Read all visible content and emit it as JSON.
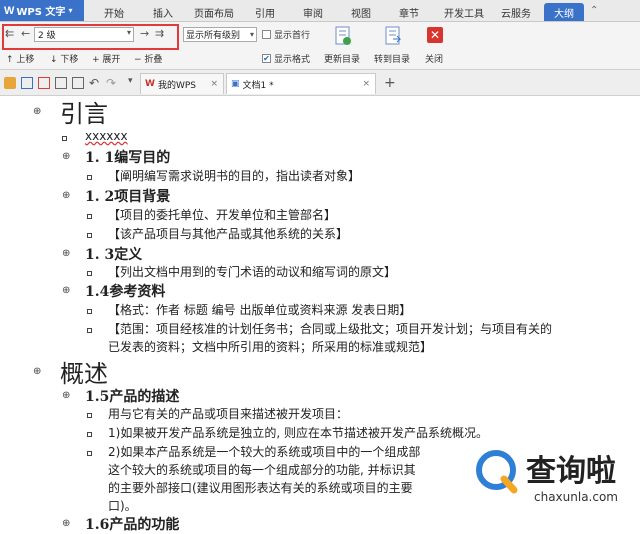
{
  "app": {
    "name": "WPS 文字"
  },
  "menu_tabs": [
    "开始",
    "插入",
    "页面布局",
    "引用",
    "审阅",
    "视图",
    "章节",
    "开发工具",
    "云服务",
    "大纲"
  ],
  "ribbon": {
    "level_value": "2 级",
    "show_levels_value": "显示所有级别",
    "show_first_line": "显示首行",
    "show_format": "显示格式",
    "move_up": "上移",
    "move_down": "下移",
    "expand": "展开",
    "collapse": "折叠",
    "update_toc": "更新目录",
    "goto_toc": "转到目录",
    "close": "关闭"
  },
  "doc_tabs": [
    {
      "label": "我的WPS"
    },
    {
      "label": "文档1 *"
    }
  ],
  "outline": {
    "h1_intro": "引言",
    "placeholder": "xxxxxx",
    "h2_1": "1. 1编写目的",
    "b_1_1": "【阐明编写需求说明书的目的，指出读者对象】",
    "h2_2": "1. 2项目背景",
    "b_2_1": "【项目的委托单位、开发单位和主管部名】",
    "b_2_2": "【该产品项目与其他产品或其他系统的关系】",
    "h2_3": "1. 3定义",
    "b_3_1": "【列出文档中用到的专门术语的动议和缩写词的原文】",
    "h2_4": "1.4参考资料",
    "b_4_1": "【格式：作者   标题   编号   出版单位或资料来源   发表日期】",
    "b_4_2a": "【范围：项目经核准的计划任务书；合同或上级批文；项目开发计划；与项目有关的",
    "b_4_2b": "已发表的资料；文档中所引用的资料；所采用的标准或规范】",
    "h1_overview": "概述",
    "h2_5": "1.5产品的描述",
    "b_5_1": "用与它有关的产品或项目来描述被开发项目：",
    "b_5_2": "1)如果被开发产品系统是独立的, 则应在本节描述被开发产品系统概况。",
    "b_5_3a": "2)如果本产品系统是一个较大的系统或项目中的一个组成部",
    "b_5_3b": "这个较大的系统或项目的每一个组成部分的功能, 并标识其",
    "b_5_3c": "的主要外部接口(建议用图形表达有关的系统或项目的主要",
    "b_5_3d": "口)。",
    "h2_6": "1.6产品的功能"
  },
  "watermark": {
    "text": "查询啦",
    "url": "chaxunla.com"
  },
  "colors": {
    "accent": "#3a72c9",
    "highlight_box": "#e23a3a",
    "close": "#d9352f"
  }
}
